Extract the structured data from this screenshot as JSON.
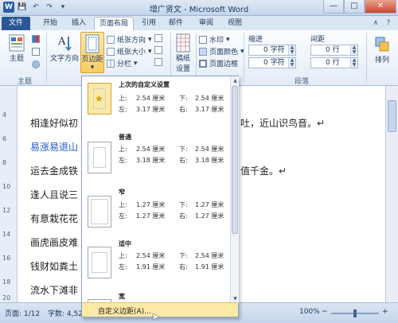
{
  "window": {
    "title": "增广贤文 - Microsoft Word",
    "word_icon": "W",
    "min_glyph": "—",
    "max_glyph": "□",
    "close_glyph": "✕"
  },
  "qat": {
    "save_glyph": "💾",
    "undo_glyph": "↶",
    "redo_glyph": "↷",
    "more_glyph": "▾"
  },
  "tabs": [
    {
      "label": "文件"
    },
    {
      "label": "开始"
    },
    {
      "label": "插入"
    },
    {
      "label": "页面布局"
    },
    {
      "label": "引用"
    },
    {
      "label": "邮件"
    },
    {
      "label": "审阅"
    },
    {
      "label": "视图"
    }
  ],
  "tab_right": {
    "minimize_glyph": "∧",
    "help_glyph": "?"
  },
  "ribbon": {
    "theme_label": "主题",
    "text_direction_label": "文字方向",
    "margins_label": "页边距",
    "orientation_label": "纸张方向",
    "size_label": "纸张大小",
    "columns_label": "分栏",
    "manuscript_label": "稿纸\n设置",
    "manuscript_l1": "稿纸",
    "manuscript_l2": "设置",
    "watermark_label": "水印",
    "page_color_label": "页面颜色",
    "page_border_label": "页面边框",
    "indent_label": "缩进",
    "spacing_label": "间距",
    "indent_left": "0 字符",
    "indent_right": "0 字符",
    "spacing_before": "0 行",
    "spacing_after": "0 行",
    "arrange_label": "排列",
    "group_theme": "主题",
    "group_paragraph": "段落",
    "dropdown_glyph": "▾"
  },
  "ruler": {
    "marks": [
      "4",
      "6",
      "8",
      "10",
      "12",
      "14",
      "16",
      "18",
      "20"
    ]
  },
  "document": {
    "lines": [
      {
        "text": "相逢好似初",
        "tail": "吐，近山识鸟音。↵",
        "blue": false
      },
      {
        "text": "易涨易退山",
        "tail": "",
        "blue": true
      },
      {
        "text": "运去金成铁",
        "tail": "值千金。↵",
        "blue": false
      },
      {
        "text": "逢人且说三",
        "tail": "",
        "blue": false
      },
      {
        "text": "有意栽花花",
        "tail": "",
        "blue": false
      },
      {
        "text": "画虎画皮难",
        "tail": "",
        "blue": false
      },
      {
        "text": "钱财如粪土",
        "tail": "",
        "blue": false
      },
      {
        "text": "流水下滩非",
        "tail": "",
        "blue": false
      }
    ]
  },
  "margins_menu": {
    "presets": [
      {
        "name": "上次的自定义设置",
        "top_label": "上:",
        "top": "2.54 厘米",
        "bottom_label": "下:",
        "bottom": "2.54 厘米",
        "left_label": "左:",
        "left": "3.17 厘米",
        "right_label": "右:",
        "right": "3.17 厘米",
        "selected": true
      },
      {
        "name": "普通",
        "top_label": "上:",
        "top": "2.54 厘米",
        "bottom_label": "下:",
        "bottom": "2.54 厘米",
        "left_label": "左:",
        "left": "3.18 厘米",
        "right_label": "右:",
        "right": "3.18 厘米",
        "selected": false
      },
      {
        "name": "窄",
        "top_label": "上:",
        "top": "1.27 厘米",
        "bottom_label": "下:",
        "bottom": "1.27 厘米",
        "left_label": "左:",
        "left": "1.27 厘米",
        "right_label": "右:",
        "right": "1.27 厘米",
        "selected": false
      },
      {
        "name": "适中",
        "top_label": "上:",
        "top": "2.54 厘米",
        "bottom_label": "下:",
        "bottom": "2.54 厘米",
        "left_label": "左:",
        "left": "1.91 厘米",
        "right_label": "右:",
        "right": "1.91 厘米",
        "selected": false
      },
      {
        "name": "宽",
        "top_label": "",
        "top": "",
        "bottom_label": "",
        "bottom": "",
        "left_label": "",
        "left": "",
        "right_label": "",
        "right": "",
        "selected": false
      }
    ],
    "custom_label": "自定义边距(A)...",
    "star_glyph": "★"
  },
  "statusbar": {
    "page": "页面: 1/12",
    "words": "字数: 4,52",
    "zoom": "100%",
    "zoom_minus": "−",
    "zoom_plus": "+"
  },
  "colors": {
    "accent": "#2b5797",
    "highlight": "#fde9a6",
    "link_text": "#1b56c8"
  }
}
